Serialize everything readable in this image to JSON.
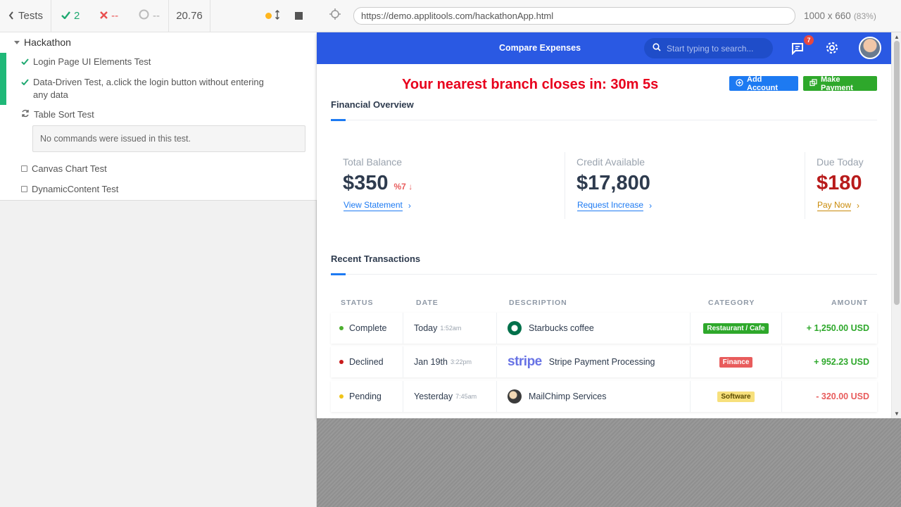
{
  "runner": {
    "header": {
      "back_label": "Tests",
      "passed_count": "2",
      "failed_count": "--",
      "pending_count": "--",
      "duration": "20.76"
    },
    "suite": {
      "title": "Hackathon",
      "tests": [
        {
          "title": "Login Page UI Elements Test",
          "state": "passed"
        },
        {
          "title": "Data-Driven Test, a.click the login button without entering any data",
          "state": "passed"
        },
        {
          "title": "Table Sort Test",
          "state": "running",
          "note": "No commands were issued in this test."
        },
        {
          "title": "Canvas Chart Test",
          "state": "queued"
        },
        {
          "title": "DynamicContent Test",
          "state": "queued"
        }
      ]
    }
  },
  "aut": {
    "url": "https://demo.applitools.com/hackathonApp.html",
    "viewport": "1000 x 660",
    "scale": "(83%)"
  },
  "app": {
    "nav": {
      "title": "Compare Expenses",
      "search_placeholder": "Start typing to search...",
      "notification_count": "7"
    },
    "countdown": "Your nearest branch closes in: 30m 5s",
    "buttons": {
      "add_account": "Add Account",
      "make_payment": "Make Payment"
    },
    "financial_overview": {
      "title": "Financial Overview",
      "cards": [
        {
          "label": "Total Balance",
          "value": "$350",
          "change": "%7 ↓",
          "link": "View Statement",
          "value_color": "#2e3b4e",
          "link_color": "#1d7af2"
        },
        {
          "label": "Credit Available",
          "value": "$17,800",
          "change": "",
          "link": "Request Increase",
          "value_color": "#2e3b4e",
          "link_color": "#1d7af2"
        },
        {
          "label": "Due Today",
          "value": "$180",
          "change": "",
          "link": "Pay Now",
          "value_color": "#b81b1b",
          "link_color": "#c98a09"
        }
      ]
    },
    "transactions": {
      "title": "Recent Transactions",
      "columns": [
        "STATUS",
        "DATE",
        "DESCRIPTION",
        "CATEGORY",
        "AMOUNT"
      ],
      "rows": [
        {
          "status": "Complete",
          "status_color": "#4caf2f",
          "date": "Today",
          "time": "1:52am",
          "logo": "starbucks",
          "description": "Starbucks coffee",
          "category": "Restaurant / Cafe",
          "category_color": "#2ea82b",
          "amount": "+ 1,250.00 USD",
          "amount_color": "#2ea82b"
        },
        {
          "status": "Declined",
          "status_color": "#c81b1b",
          "date": "Jan 19th",
          "time": "3:22pm",
          "logo": "stripe",
          "description": "Stripe Payment Processing",
          "category": "Finance",
          "category_color": "#e85c5c",
          "amount": "+ 952.23 USD",
          "amount_color": "#2ea82b"
        },
        {
          "status": "Pending",
          "status_color": "#f0c419",
          "date": "Yesterday",
          "time": "7:45am",
          "logo": "mailchimp",
          "description": "MailChimp Services",
          "category": "Software",
          "category_color": "#f7e07c",
          "amount": "- 320.00 USD",
          "amount_color": "#e85c5c"
        }
      ]
    }
  },
  "colors": {
    "nav_blue": "#2a59e3",
    "pass_green": "#1fa971",
    "fail_red": "#e94f4f",
    "countdown_red": "#e8001d"
  }
}
